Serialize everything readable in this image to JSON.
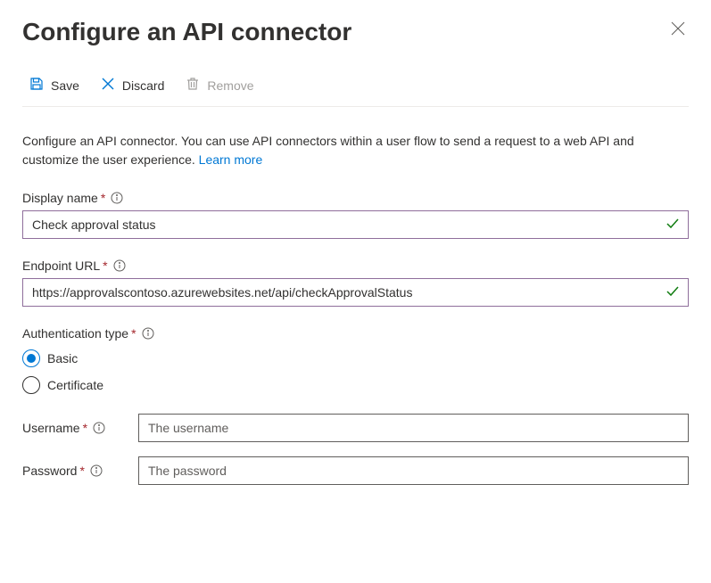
{
  "header": {
    "title": "Configure an API connector"
  },
  "toolbar": {
    "save_label": "Save",
    "discard_label": "Discard",
    "remove_label": "Remove"
  },
  "description": {
    "text": "Configure an API connector. You can use API connectors within a user flow to send a request to a web API and customize the user experience. ",
    "link_text": "Learn more"
  },
  "fields": {
    "display_name": {
      "label": "Display name",
      "value": "Check approval status"
    },
    "endpoint_url": {
      "label": "Endpoint URL",
      "value": "https://approvalscontoso.azurewebsites.net/api/checkApprovalStatus"
    },
    "auth_type": {
      "label": "Authentication type",
      "options": {
        "basic": "Basic",
        "certificate": "Certificate"
      }
    },
    "username": {
      "label": "Username",
      "placeholder": "The username"
    },
    "password": {
      "label": "Password",
      "placeholder": "The password"
    }
  }
}
